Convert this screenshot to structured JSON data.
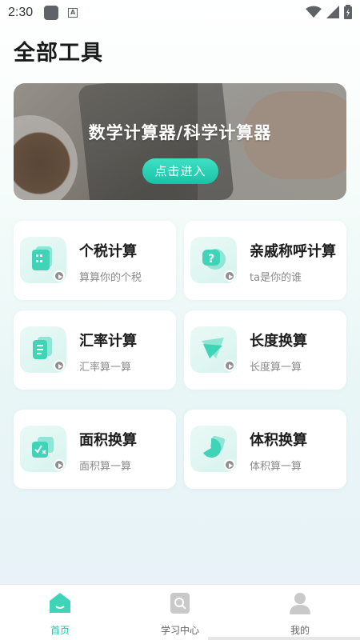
{
  "status_bar": {
    "time": "2:30",
    "icons": [
      "app-square-icon",
      "a-box-icon",
      "wifi-icon",
      "signal-icon",
      "battery-icon"
    ]
  },
  "page": {
    "title": "全部工具"
  },
  "banner": {
    "title": "数学计算器/科学计算器",
    "button_label": "点击进入"
  },
  "tools": [
    {
      "title": "个税计算",
      "subtitle": "算算你的个税",
      "icon": "tax-calculator-icon"
    },
    {
      "title": "亲戚称呼计算",
      "subtitle": "ta是你的谁",
      "icon": "question-bubble-icon"
    },
    {
      "title": "汇率计算",
      "subtitle": "汇率算一算",
      "icon": "document-icon"
    },
    {
      "title": "长度换算",
      "subtitle": "长度算一算",
      "icon": "ruler-triangle-icon"
    },
    {
      "title": "面积换算",
      "subtitle": "面积算一算",
      "icon": "math-card-icon"
    },
    {
      "title": "体积换算",
      "subtitle": "体积算一算",
      "icon": "pie-shape-icon"
    }
  ],
  "bottom_nav": [
    {
      "label": "首页",
      "icon": "home-icon",
      "active": true
    },
    {
      "label": "学习中心",
      "icon": "book-search-icon",
      "active": false
    },
    {
      "label": "我的",
      "icon": "user-icon",
      "active": false
    }
  ],
  "colors": {
    "accent": "#1fc6a9",
    "icon_tint": "#3fd4b8"
  }
}
